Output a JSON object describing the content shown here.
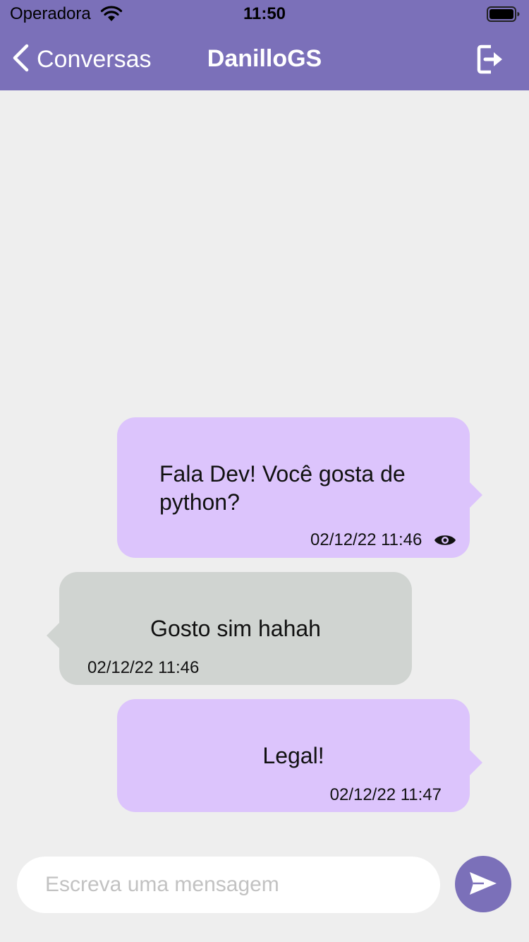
{
  "status_bar": {
    "carrier": "Operadora",
    "time": "11:50",
    "wifi_icon": "wifi-icon",
    "battery_icon": "battery-icon"
  },
  "header": {
    "back_label": "Conversas",
    "title": "DanilloGS",
    "back_icon": "chevron-left-icon",
    "logout_icon": "logout-icon"
  },
  "messages": [
    {
      "direction": "sent",
      "text": "Fala Dev! Você gosta de python?",
      "time": "02/12/22 11:46",
      "seen_icon": "eye-icon"
    },
    {
      "direction": "received",
      "text": "Gosto sim hahah",
      "time": "02/12/22 11:46"
    },
    {
      "direction": "sent",
      "text": "Legal!",
      "time": "02/12/22 11:47"
    }
  ],
  "composer": {
    "placeholder": "Escreva uma mensagem",
    "value": "",
    "send_icon": "send-icon"
  },
  "colors": {
    "header": "#7b70b9",
    "sent_bubble": "#dcc4fc",
    "received_bubble": "#d0d4d1",
    "background": "#eeeeee"
  }
}
